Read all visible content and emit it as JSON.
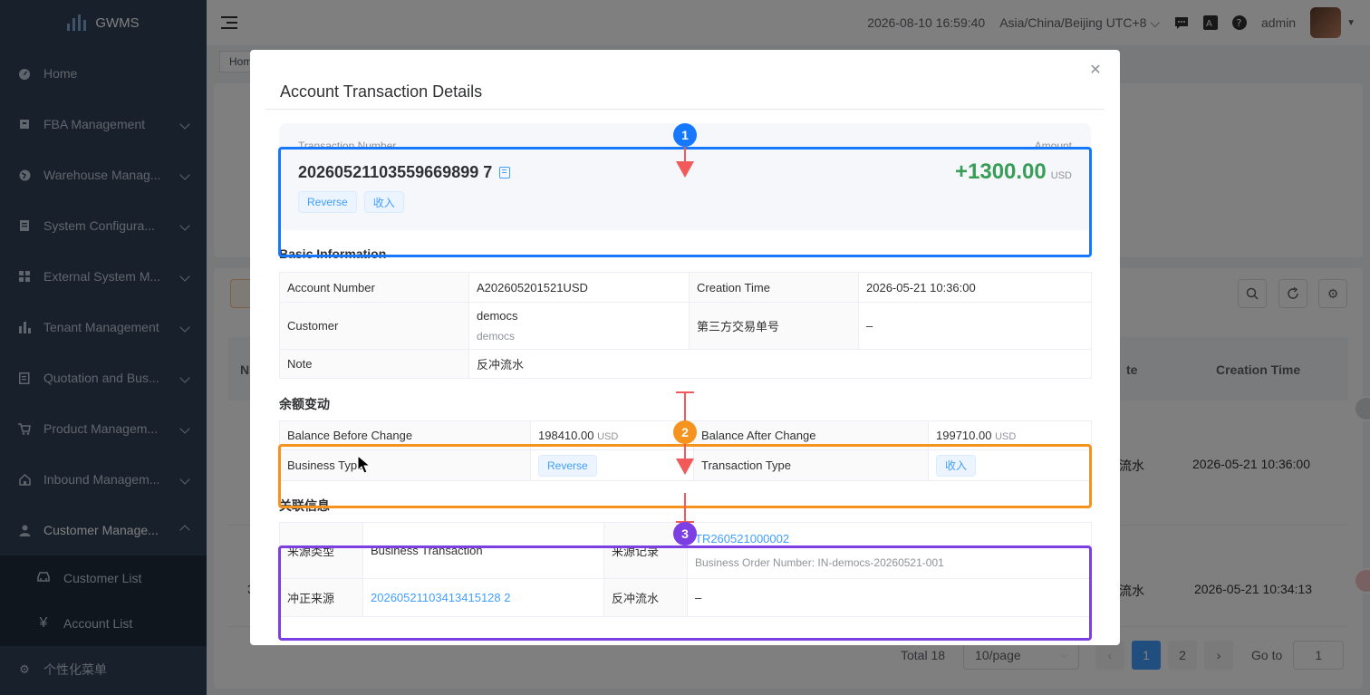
{
  "app": {
    "name": "GWMS"
  },
  "sidebar": {
    "items": [
      {
        "label": "Home",
        "icon": "dashboard-icon",
        "has_children": false
      },
      {
        "label": "FBA Management",
        "icon": "box-icon",
        "has_children": true
      },
      {
        "label": "Warehouse Manag...",
        "icon": "globe-icon",
        "has_children": true
      },
      {
        "label": "System Configura...",
        "icon": "server-icon",
        "has_children": true
      },
      {
        "label": "External System M...",
        "icon": "grid-icon",
        "has_children": true
      },
      {
        "label": "Tenant Management",
        "icon": "bar-chart-icon",
        "has_children": true
      },
      {
        "label": "Quotation and Bus...",
        "icon": "document-icon",
        "has_children": true
      },
      {
        "label": "Product Managem...",
        "icon": "cart-icon",
        "has_children": true
      },
      {
        "label": "Inbound Managem...",
        "icon": "home-icon",
        "has_children": true
      },
      {
        "label": "Customer Manage...",
        "icon": "user-icon",
        "has_children": true,
        "expanded": true
      }
    ],
    "subitems": [
      {
        "label": "Customer List",
        "icon": "car-icon"
      },
      {
        "label": "Account List",
        "icon": "yen-icon",
        "glyph": "¥"
      }
    ],
    "footer": {
      "label": "个性化菜单",
      "icon": "gear-icon"
    }
  },
  "header": {
    "datetime": "2026-08-10 16:59:40",
    "timezone": "Asia/China/Beijing UTC+8",
    "user": "admin"
  },
  "background": {
    "breadcrumb": "Hom",
    "col_header_left": "N",
    "col_header_mid": "te",
    "col_header_creation": "Creation Time",
    "rows": [
      {
        "note": "流水",
        "time": "2026-05-21 10:36:00"
      },
      {
        "note": "流水",
        "time": "2026-05-21 10:34:13"
      }
    ],
    "row_prefix_2": "3"
  },
  "pagination": {
    "total": "Total 18",
    "page_size": "10/page",
    "pages": [
      "1",
      "2"
    ],
    "current": "1",
    "goto_label": "Go to",
    "goto_value": "1"
  },
  "modal": {
    "title": "Account Transaction Details",
    "summary": {
      "number_label": "Transaction Number",
      "number": "20260521103559669899 7",
      "amount_label": "Amount",
      "amount": "+1300.00",
      "currency": "USD",
      "tags": [
        "Reverse",
        "收入"
      ]
    },
    "basic": {
      "title": "Basic Information",
      "account_number_label": "Account Number",
      "account_number": "A202605201521USD",
      "creation_time_label": "Creation Time",
      "creation_time": "2026-05-21 10:36:00",
      "customer_label": "Customer",
      "customer": "democs",
      "customer_sub": "democs",
      "third_party_label": "第三方交易单号",
      "third_party": "–",
      "note_label": "Note",
      "note": "反冲流水"
    },
    "balance": {
      "title": "余额变动",
      "before_label": "Balance Before Change",
      "before": "198410.00",
      "before_cur": "USD",
      "after_label": "Balance After Change",
      "after": "199710.00",
      "after_cur": "USD",
      "business_type_label": "Business Type",
      "business_type": "Reverse",
      "transaction_type_label": "Transaction Type",
      "transaction_type": "收入"
    },
    "related": {
      "title": "关联信息",
      "source_type_label": "来源类型",
      "source_type": "Business Transaction",
      "source_record_label": "来源记录",
      "source_record": "TR260521000002",
      "source_record_sub": "Business Order Number: IN-democs-20260521-001",
      "reversal_source_label": "冲正来源",
      "reversal_source": "20260521103413415128 2",
      "reversal_flow_label": "反冲流水",
      "reversal_flow": "–"
    }
  },
  "annotations": [
    {
      "number": "1",
      "color": "#1677ff"
    },
    {
      "number": "2",
      "color": "#f5931e"
    },
    {
      "number": "3",
      "color": "#7b3fe4"
    }
  ],
  "colors": {
    "sidebar": "#304156",
    "primary": "#409eff",
    "amount": "#389e57",
    "arrow": "#f05a5a"
  }
}
